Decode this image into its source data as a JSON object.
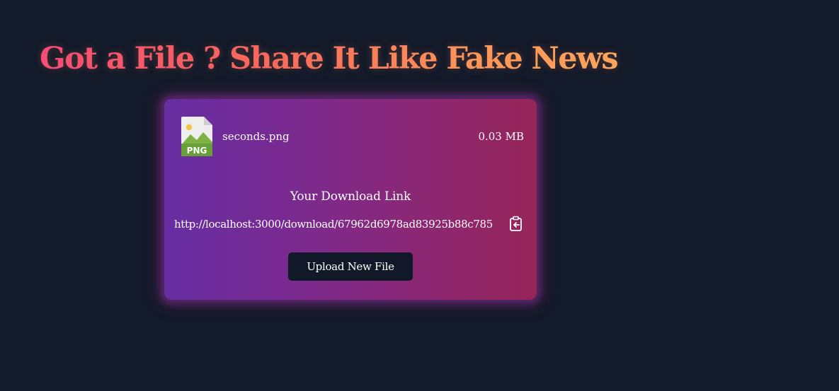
{
  "headline": "Got a File ? Share It Like Fake News",
  "file": {
    "icon": "png-file-icon",
    "icon_label": "PNG",
    "name": "seconds.png",
    "size": "0.03 MB"
  },
  "download": {
    "heading": "Your Download Link",
    "url": "http://localhost:3000/download/67962d6978ad83925b88c785",
    "copy_icon": "clipboard-copy-icon"
  },
  "actions": {
    "upload_new_label": "Upload New File"
  },
  "colors": {
    "background": "#131a29",
    "headline_gradient_start": "#f5457a",
    "headline_gradient_end": "#fdab5c",
    "card_gradient_start": "#662ea2",
    "card_gradient_end": "#962558",
    "button_background": "#111827"
  }
}
